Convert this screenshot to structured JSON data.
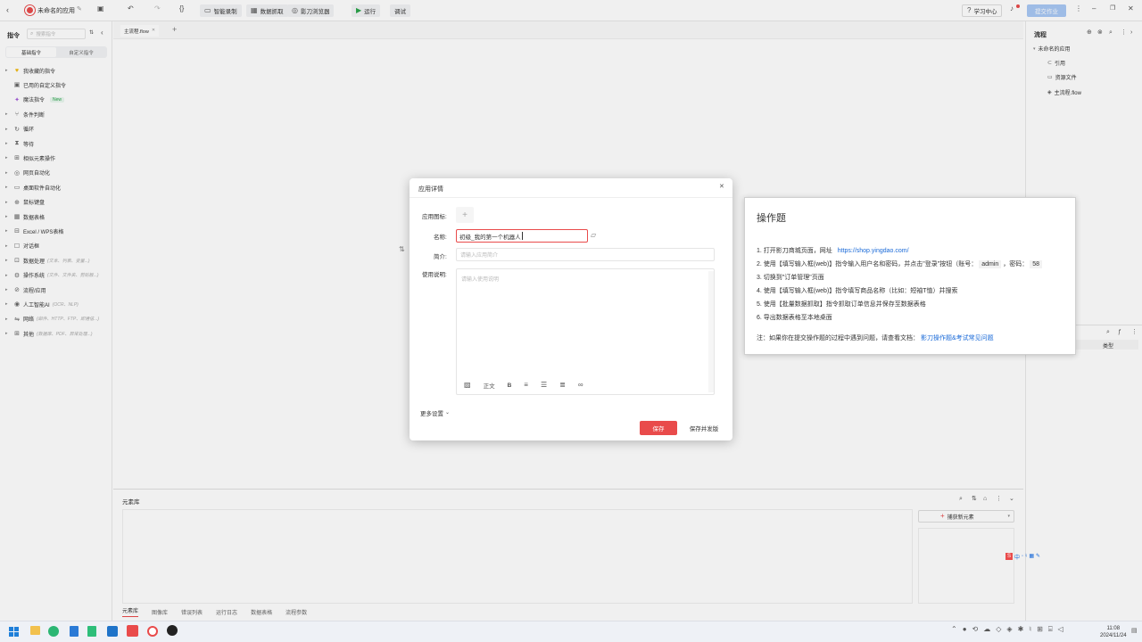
{
  "app": {
    "name": "未命名的应用"
  },
  "toolbar": {
    "smart_record": "智能录制",
    "data_capture": "数据抓取",
    "browser": "影刀浏览器",
    "run": "运行",
    "debug": "调试",
    "learning_center": "学习中心",
    "publish": "提交作业"
  },
  "left_panel": {
    "title": "指令",
    "search_placeholder": "搜索指令",
    "tab_system": "基础指令",
    "tab_custom": "自定义指令",
    "items": [
      {
        "label": "我收藏的指令",
        "sub": ""
      },
      {
        "label": "已用的自定义指令",
        "sub": ""
      },
      {
        "label": "魔法指令",
        "sub": "",
        "badge": "New"
      },
      {
        "label": "条件判断",
        "sub": ""
      },
      {
        "label": "循环",
        "sub": ""
      },
      {
        "label": "等待",
        "sub": ""
      },
      {
        "label": "相似元素操作",
        "sub": ""
      },
      {
        "label": "网页自动化",
        "sub": ""
      },
      {
        "label": "桌面软件自动化",
        "sub": ""
      },
      {
        "label": "鼠标键盘",
        "sub": ""
      },
      {
        "label": "数据表格",
        "sub": ""
      },
      {
        "label": "Excel / WPS表格",
        "sub": ""
      },
      {
        "label": "对话框",
        "sub": ""
      },
      {
        "label": "数据处理",
        "sub": "(文本、列表、变量...)"
      },
      {
        "label": "操作系统",
        "sub": "(文件、文件夹、剪贴板...)"
      },
      {
        "label": "流程/应用",
        "sub": ""
      },
      {
        "label": "人工智能AI",
        "sub": "(OCR、NLP)"
      },
      {
        "label": "网络",
        "sub": "(邮件、HTTP、FTP、即通信...)"
      },
      {
        "label": "其他",
        "sub": "(数据库、PDF、异常处理...)"
      }
    ]
  },
  "canvas": {
    "tab_main": "主流程.flow"
  },
  "right_panel": {
    "title": "流程",
    "root": "未命名的应用",
    "items": [
      "引用",
      "资源文件",
      "主流程.flow"
    ],
    "var_col_type": "类型"
  },
  "bottom_panel": {
    "title": "元素库",
    "capture_button": "捕获新元素",
    "tabs": [
      "元素库",
      "图像库",
      "错误列表",
      "运行日志",
      "数据表格",
      "流程参数"
    ]
  },
  "dialog": {
    "title": "应用详情",
    "icon_label": "应用图标:",
    "name_label": "名称:",
    "name_value": "初级_我的第一个机器人",
    "intro_label": "简介:",
    "intro_placeholder": "请输入应用简介",
    "desc_label": "使用说明:",
    "desc_placeholder": "请输入使用说明",
    "editor_text_style": "正文",
    "more_settings": "更多设置",
    "save": "保存",
    "save_publish": "保存并发版"
  },
  "card": {
    "title": "操作题",
    "steps": [
      "1. 打开影刀商城页面，网址",
      "2. 使用【填写输入框(web)】指令输入用户名和密码，并点击\"登录\"按钮（账号：",
      "3. 切换到\"订单管理\"页面",
      "4. 使用【填写输入框(web)】指令填写商品名称（比如：短袖T恤）并搜索",
      "5. 使用【批量数据抓取】指令抓取订单信息并保存至数据表格",
      "6. 导出数据表格至本地桌面"
    ],
    "url": "https://shop.yingdao.com/",
    "account": "admin",
    "password_label": "，密码：",
    "password_partial": "58",
    "note_prefix": "注：如果你在提交操作题的过程中遇到问题，请查看文档：",
    "note_link": "影刀操作题&考试常见问题"
  },
  "ime": {
    "text": "中"
  },
  "taskbar": {
    "time": "11:08",
    "date": "2024/11/24"
  },
  "colors": {
    "accent": "#e94b4b",
    "link": "#1a6ad8",
    "publish_btn": "#a8c8f5"
  }
}
